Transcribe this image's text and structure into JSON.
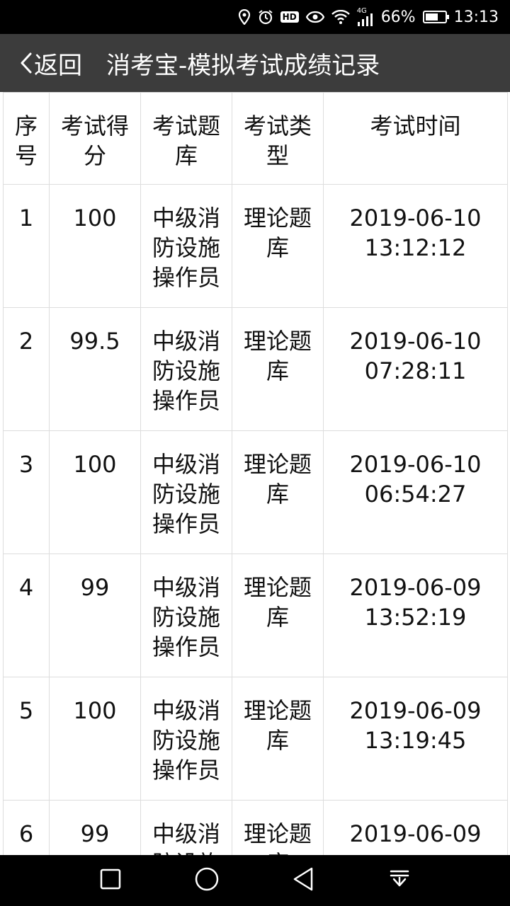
{
  "status_bar": {
    "hd": "HD",
    "network": "4G",
    "battery": "66%",
    "battery_level": 0.66,
    "time": "13:13"
  },
  "header": {
    "back_label": "返回",
    "title": "消考宝-模拟考试成绩记录"
  },
  "table": {
    "columns": [
      "序号",
      "考试得分",
      "考试题库",
      "考试类型",
      "考试时间"
    ],
    "rows": [
      {
        "index": "1",
        "score": "100",
        "bank": "中级消防设施操作员",
        "type": "理论题库",
        "date": "2019-06-10",
        "time": "13:12:12"
      },
      {
        "index": "2",
        "score": "99.5",
        "bank": "中级消防设施操作员",
        "type": "理论题库",
        "date": "2019-06-10",
        "time": "07:28:11"
      },
      {
        "index": "3",
        "score": "100",
        "bank": "中级消防设施操作员",
        "type": "理论题库",
        "date": "2019-06-10",
        "time": "06:54:27"
      },
      {
        "index": "4",
        "score": "99",
        "bank": "中级消防设施操作员",
        "type": "理论题库",
        "date": "2019-06-09",
        "time": "13:52:19"
      },
      {
        "index": "5",
        "score": "100",
        "bank": "中级消防设施操作员",
        "type": "理论题库",
        "date": "2019-06-09",
        "time": "13:19:45"
      },
      {
        "index": "6",
        "score": "99",
        "bank": "中级消防设施操作员",
        "type": "理论题库",
        "date": "2019-06-09",
        "time": ""
      }
    ]
  }
}
